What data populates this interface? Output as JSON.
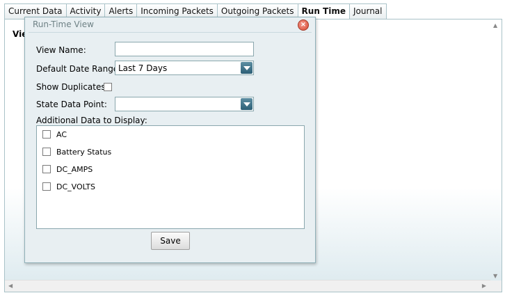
{
  "tabs": [
    {
      "label": "Current Data"
    },
    {
      "label": "Activity"
    },
    {
      "label": "Alerts"
    },
    {
      "label": "Incoming Packets"
    },
    {
      "label": "Outgoing Packets"
    },
    {
      "label": "Run Time",
      "active": true
    },
    {
      "label": "Journal"
    }
  ],
  "content": {
    "partial_heading": "Vie"
  },
  "dialog": {
    "title": "Run-Time View",
    "close_icon": "close-icon",
    "view_name": {
      "label": "View Name:",
      "value": ""
    },
    "date_range": {
      "label": "Default Date Range:",
      "value": "Last 7 Days"
    },
    "show_duplicates": {
      "label": "Show Duplicates:",
      "checked": false
    },
    "state_data_point": {
      "label": "State Data Point:",
      "value": ""
    },
    "additional": {
      "label": "Additional Data to Display:",
      "items": [
        {
          "label": "AC",
          "checked": false
        },
        {
          "label": "Battery Status",
          "checked": false
        },
        {
          "label": "DC_AMPS",
          "checked": false
        },
        {
          "label": "DC_VOLTS",
          "checked": false
        }
      ]
    },
    "save_label": "Save"
  }
}
